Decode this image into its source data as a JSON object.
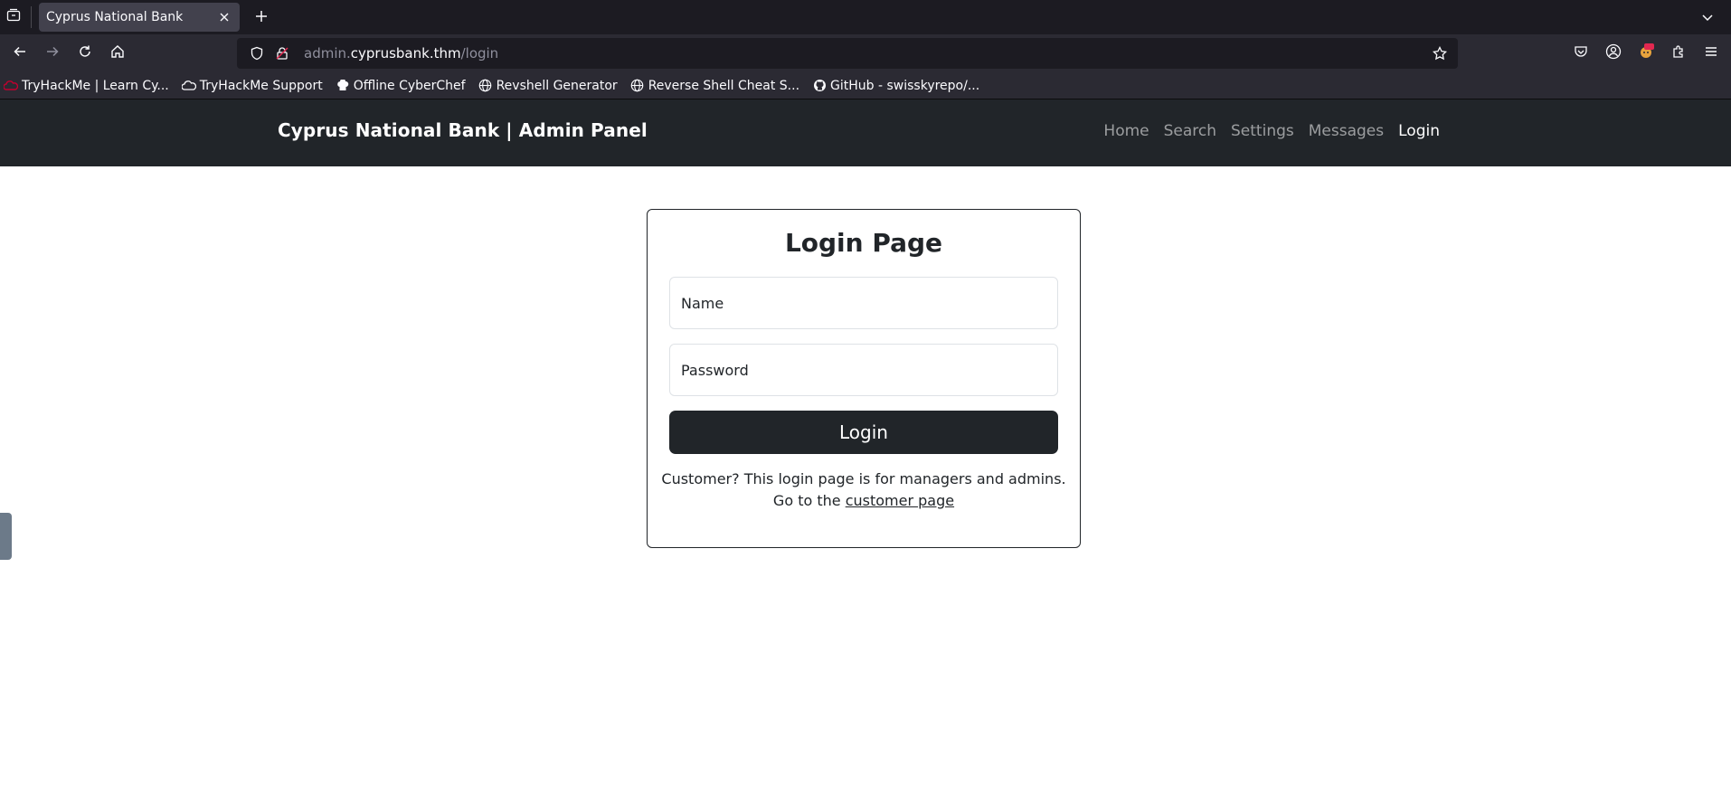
{
  "browser": {
    "tab": {
      "title": "Cyprus National Bank"
    },
    "url": {
      "host_prefix": "admin.",
      "host": "cyprusbank.thm",
      "path": "/login"
    },
    "bookmarks": [
      {
        "label": "TryHackMe | Learn Cy...",
        "icon": "tryhackme-icon"
      },
      {
        "label": "TryHackMe Support",
        "icon": "cloud-icon"
      },
      {
        "label": "Offline CyberChef",
        "icon": "chef-icon"
      },
      {
        "label": "Revshell Generator",
        "icon": "globe-icon"
      },
      {
        "label": "Reverse Shell Cheat S...",
        "icon": "globe-icon"
      },
      {
        "label": "GitHub - swisskyrepo/...",
        "icon": "github-icon"
      }
    ]
  },
  "site": {
    "brand": "Cyprus National Bank | Admin Panel",
    "nav": [
      {
        "label": "Home"
      },
      {
        "label": "Search"
      },
      {
        "label": "Settings"
      },
      {
        "label": "Messages"
      },
      {
        "label": "Login"
      }
    ]
  },
  "login": {
    "title": "Login Page",
    "name_placeholder": "Name",
    "password_placeholder": "Password",
    "button_label": "Login",
    "note_line1": "Customer? This login page is for managers and admins.",
    "note_line2_prefix": "Go to the ",
    "note_link": "customer page"
  },
  "colors": {
    "header_bg": "#212529",
    "button_bg": "#212529",
    "chrome_bg": "#2b2a33",
    "tabbar_bg": "#1c1b22"
  }
}
